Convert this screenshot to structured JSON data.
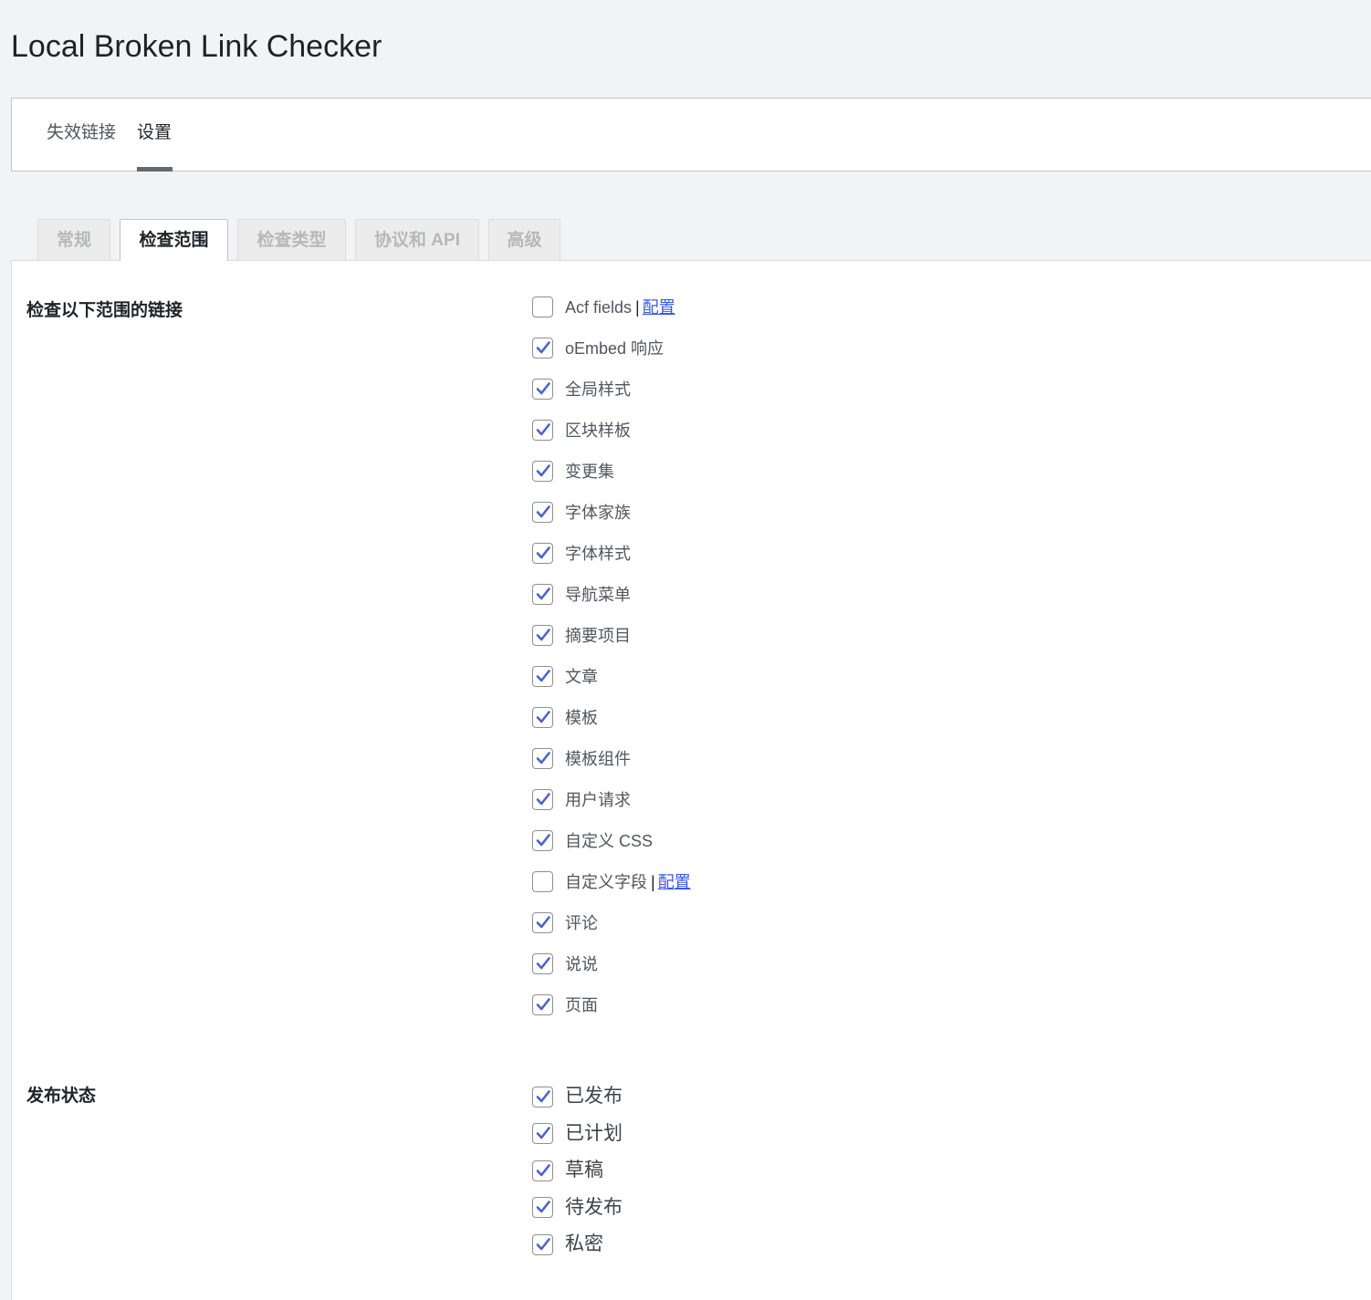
{
  "app": {
    "title": "Local Broken Link Checker"
  },
  "top_nav": {
    "items": [
      {
        "label": "失效链接"
      },
      {
        "label": "设置"
      }
    ],
    "active": "设置"
  },
  "sub_tabs": {
    "items": [
      {
        "label": "常规"
      },
      {
        "label": "检查范围"
      },
      {
        "label": "检查类型"
      },
      {
        "label": "协议和 API"
      },
      {
        "label": "高级"
      }
    ],
    "active": "检查范围"
  },
  "scope_section": {
    "label": "检查以下范围的链接",
    "options": [
      {
        "label": "Acf fields",
        "checked": false,
        "link": "配置"
      },
      {
        "label": "oEmbed 响应",
        "checked": true
      },
      {
        "label": "全局样式",
        "checked": true
      },
      {
        "label": "区块样板",
        "checked": true
      },
      {
        "label": "变更集",
        "checked": true
      },
      {
        "label": "字体家族",
        "checked": true
      },
      {
        "label": "字体样式",
        "checked": true
      },
      {
        "label": "导航菜单",
        "checked": true
      },
      {
        "label": "摘要项目",
        "checked": true
      },
      {
        "label": "文章",
        "checked": true
      },
      {
        "label": "模板",
        "checked": true
      },
      {
        "label": "模板组件",
        "checked": true
      },
      {
        "label": "用户请求",
        "checked": true
      },
      {
        "label": "自定义 CSS",
        "checked": true
      },
      {
        "label": "自定义字段",
        "checked": false,
        "link": "配置"
      },
      {
        "label": "评论",
        "checked": true
      },
      {
        "label": "说说",
        "checked": true
      },
      {
        "label": "页面",
        "checked": true
      }
    ]
  },
  "status_section": {
    "label": "发布状态",
    "options": [
      {
        "label": "已发布",
        "checked": true
      },
      {
        "label": "已计划",
        "checked": true
      },
      {
        "label": "草稿",
        "checked": true
      },
      {
        "label": "待发布",
        "checked": true
      },
      {
        "label": "私密",
        "checked": true
      }
    ]
  },
  "ui": {
    "separator": "|",
    "check_color": "#4f62c8",
    "link_color": "#3858e9"
  }
}
